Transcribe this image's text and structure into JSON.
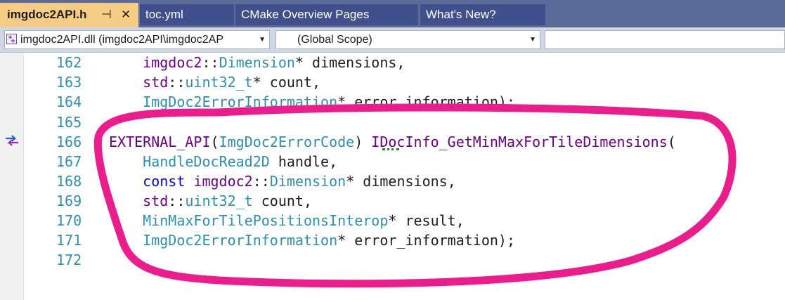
{
  "tabs": [
    {
      "label": "imgdoc2API.h",
      "active": true
    },
    {
      "label": "toc.yml",
      "active": false
    },
    {
      "label": "CMake Overview Pages",
      "active": false
    },
    {
      "label": "What's New?",
      "active": false
    }
  ],
  "tab_glyphs": {
    "pin": "⊣",
    "close": "✕"
  },
  "navbar": {
    "project_combo": "imgdoc2API.dll (imgdoc2API\\imgdoc2AP",
    "scope_combo": "(Global Scope)",
    "member_combo": ""
  },
  "icons": {
    "project": "project-file-icon",
    "dropdown": "dropdown-arrow-icon",
    "navigation_marker": "code-navigation-icon"
  },
  "colors": {
    "tab_active": "#f5cc84",
    "tab_inactive": "#40508d",
    "tabstrip_bg": "#5d6b99",
    "line_number": "#2b91af",
    "annotation_stroke": "#ec1c8c"
  },
  "code_lines": [
    {
      "number": "162",
      "tokens": [
        [
          "    ",
          "plain"
        ],
        [
          "imgdoc2",
          "ns"
        ],
        [
          "::",
          "plain"
        ],
        [
          "Dimension",
          "type"
        ],
        [
          "* dimensions,",
          "plain"
        ]
      ]
    },
    {
      "number": "163",
      "tokens": [
        [
          "    ",
          "plain"
        ],
        [
          "std",
          "ns"
        ],
        [
          "::",
          "plain"
        ],
        [
          "uint32_t",
          "type"
        ],
        [
          "* count,",
          "plain"
        ]
      ]
    },
    {
      "number": "164",
      "tokens": [
        [
          "    ",
          "plain"
        ],
        [
          "ImgDoc2ErrorInformation",
          "type"
        ],
        [
          "* error_information);",
          "plain"
        ]
      ]
    },
    {
      "number": "165",
      "tokens": []
    },
    {
      "number": "166",
      "tokens": [
        [
          "EXTERNAL_API",
          "macro"
        ],
        [
          "(",
          "plain"
        ],
        [
          "ImgDoc2ErrorCode",
          "type"
        ],
        [
          ") ",
          "plain"
        ],
        [
          "IDocInfo_GetMinMaxForTileDimensions",
          "fnp"
        ],
        [
          "(",
          "plain"
        ]
      ]
    },
    {
      "number": "167",
      "tokens": [
        [
          "    ",
          "plain"
        ],
        [
          "HandleDocRead2D",
          "type"
        ],
        [
          " handle,",
          "plain"
        ]
      ]
    },
    {
      "number": "168",
      "tokens": [
        [
          "    ",
          "plain"
        ],
        [
          "const",
          "kw"
        ],
        [
          " ",
          "plain"
        ],
        [
          "imgdoc2",
          "ns"
        ],
        [
          "::",
          "plain"
        ],
        [
          "Dimension",
          "type"
        ],
        [
          "* dimensions,",
          "plain"
        ]
      ]
    },
    {
      "number": "169",
      "tokens": [
        [
          "    ",
          "plain"
        ],
        [
          "std",
          "ns"
        ],
        [
          "::",
          "plain"
        ],
        [
          "uint32_t",
          "type"
        ],
        [
          " count,",
          "plain"
        ]
      ]
    },
    {
      "number": "170",
      "tokens": [
        [
          "    ",
          "plain"
        ],
        [
          "MinMaxForTilePositionsInterop",
          "type"
        ],
        [
          "* result,",
          "plain"
        ]
      ]
    },
    {
      "number": "171",
      "tokens": [
        [
          "    ",
          "plain"
        ],
        [
          "ImgDoc2ErrorInformation",
          "type"
        ],
        [
          "* error_information);",
          "plain"
        ]
      ]
    },
    {
      "number": "172",
      "tokens": []
    }
  ]
}
